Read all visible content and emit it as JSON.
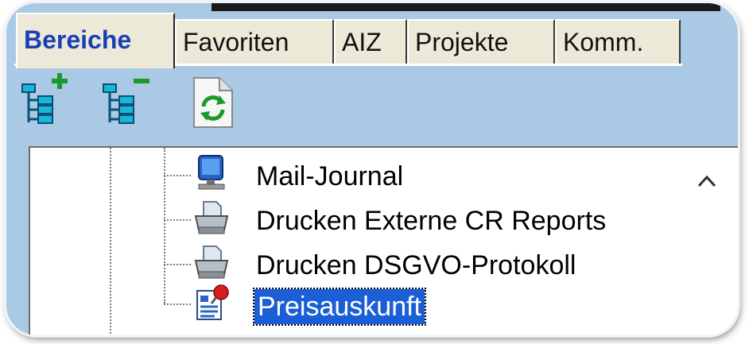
{
  "tabs": [
    {
      "label": "Bereiche",
      "active": true
    },
    {
      "label": "Favoriten",
      "active": false
    },
    {
      "label": "AIZ",
      "active": false
    },
    {
      "label": "Projekte",
      "active": false
    },
    {
      "label": "Komm.",
      "active": false
    }
  ],
  "toolbar": {
    "expand_icon": "tree-expand-icon",
    "collapse_icon": "tree-collapse-icon",
    "refresh_icon": "refresh-icon"
  },
  "tree": {
    "items": [
      {
        "label": "Mail-Journal",
        "icon": "monitor-icon",
        "selected": false
      },
      {
        "label": "Drucken Externe CR Reports",
        "icon": "printer-icon",
        "selected": false
      },
      {
        "label": "Drucken DSGVO-Protokoll",
        "icon": "printer-icon",
        "selected": false
      },
      {
        "label": "Preisauskunft",
        "icon": "pinned-document-icon",
        "selected": true
      }
    ]
  },
  "colors": {
    "panel_bg": "#a9c9e4",
    "selection": "#1a5fd6",
    "active_tab_text": "#1a3fb5"
  }
}
